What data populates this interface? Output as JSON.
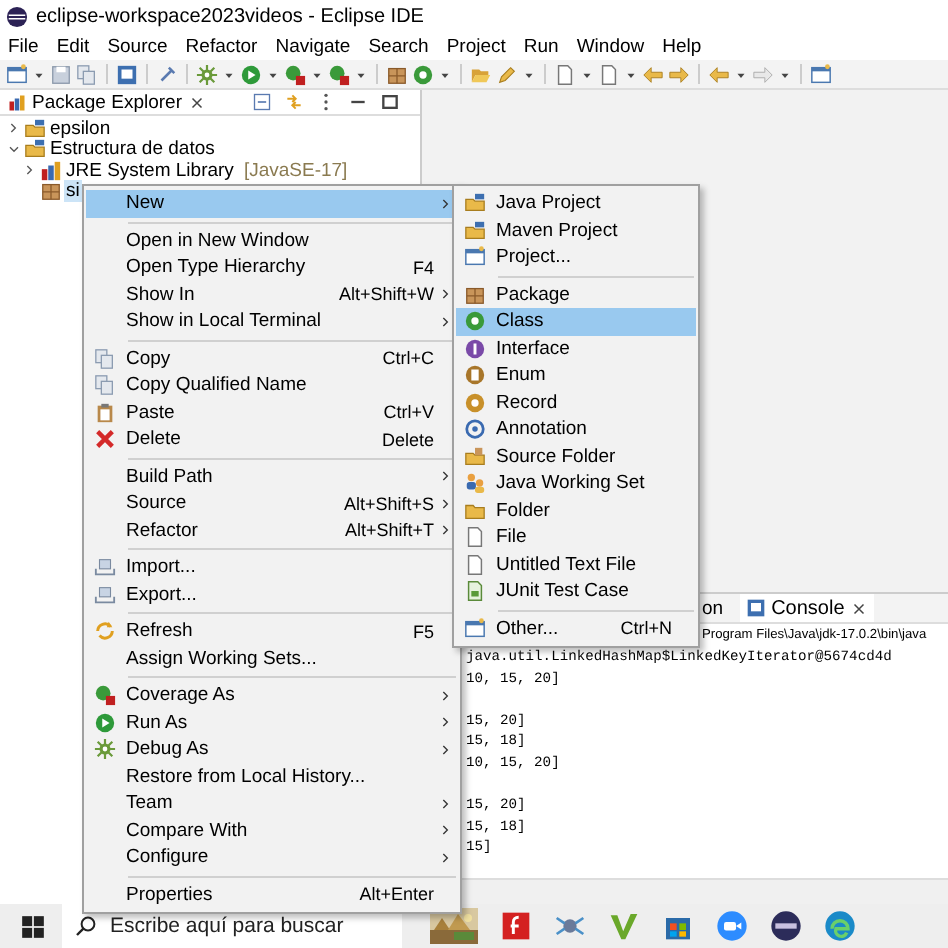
{
  "window": {
    "title": "eclipse-workspace2023videos - Eclipse IDE"
  },
  "menu_bar": [
    {
      "label": "File"
    },
    {
      "label": "Edit"
    },
    {
      "label": "Source"
    },
    {
      "label": "Refactor"
    },
    {
      "label": "Navigate"
    },
    {
      "label": "Search"
    },
    {
      "label": "Project"
    },
    {
      "label": "Run"
    },
    {
      "label": "Window"
    },
    {
      "label": "Help"
    }
  ],
  "package_explorer": {
    "title": "Package Explorer",
    "tree": [
      {
        "label": "epsilon",
        "expanded": false,
        "selected": false
      },
      {
        "label": "Estructura de datos",
        "expanded": true,
        "selected": false,
        "children": [
          {
            "label": "JRE System Library",
            "suffix": "[JavaSE-17]",
            "expanded": false,
            "selected": false
          },
          {
            "label": "si",
            "selected": true
          }
        ]
      }
    ]
  },
  "context_menu": {
    "groups": [
      [
        {
          "label": "New",
          "has_submenu": true,
          "selected": true
        }
      ],
      [
        {
          "label": "Open in New Window",
          "has_submenu": false,
          "selected": false
        },
        {
          "label": "Open Type Hierarchy",
          "shortcut": "F4",
          "has_submenu": false,
          "selected": false
        },
        {
          "label": "Show In",
          "shortcut": "Alt+Shift+W",
          "has_submenu": true,
          "selected": false
        },
        {
          "label": "Show in Local Terminal",
          "has_submenu": true,
          "selected": false
        }
      ],
      [
        {
          "label": "Copy",
          "shortcut": "Ctrl+C",
          "has_submenu": false,
          "selected": false
        },
        {
          "label": "Copy Qualified Name",
          "has_submenu": false,
          "selected": false
        },
        {
          "label": "Paste",
          "shortcut": "Ctrl+V",
          "has_submenu": false,
          "selected": false
        },
        {
          "label": "Delete",
          "shortcut": "Delete",
          "has_submenu": false,
          "selected": false
        }
      ],
      [
        {
          "label": "Build Path",
          "has_submenu": true,
          "selected": false
        },
        {
          "label": "Source",
          "shortcut": "Alt+Shift+S",
          "has_submenu": true,
          "selected": false
        },
        {
          "label": "Refactor",
          "shortcut": "Alt+Shift+T",
          "has_submenu": true,
          "selected": false
        }
      ],
      [
        {
          "label": "Import...",
          "has_submenu": false,
          "selected": false
        },
        {
          "label": "Export...",
          "has_submenu": false,
          "selected": false
        }
      ],
      [
        {
          "label": "Refresh",
          "shortcut": "F5",
          "has_submenu": false,
          "selected": false
        },
        {
          "label": "Assign Working Sets...",
          "has_submenu": false,
          "selected": false
        }
      ],
      [
        {
          "label": "Coverage As",
          "has_submenu": true,
          "selected": false
        },
        {
          "label": "Run As",
          "has_submenu": true,
          "selected": false
        },
        {
          "label": "Debug As",
          "has_submenu": true,
          "selected": false
        },
        {
          "label": "Restore from Local History...",
          "has_submenu": false,
          "selected": false
        },
        {
          "label": "Team",
          "has_submenu": true,
          "selected": false
        },
        {
          "label": "Compare With",
          "has_submenu": true,
          "selected": false
        },
        {
          "label": "Configure",
          "has_submenu": true,
          "selected": false
        }
      ],
      [
        {
          "label": "Properties",
          "shortcut": "Alt+Enter",
          "has_submenu": false,
          "selected": false
        }
      ]
    ]
  },
  "submenu": {
    "groups": [
      [
        {
          "label": "Java Project",
          "selected": false
        },
        {
          "label": "Maven Project",
          "selected": false
        },
        {
          "label": "Project...",
          "selected": false
        }
      ],
      [
        {
          "label": "Package",
          "selected": false
        },
        {
          "label": "Class",
          "selected": true
        },
        {
          "label": "Interface",
          "selected": false
        },
        {
          "label": "Enum",
          "selected": false
        },
        {
          "label": "Record",
          "selected": false
        },
        {
          "label": "Annotation",
          "selected": false
        },
        {
          "label": "Source Folder",
          "selected": false
        },
        {
          "label": "Java Working Set",
          "selected": false
        },
        {
          "label": "Folder",
          "selected": false
        },
        {
          "label": "File",
          "selected": false
        },
        {
          "label": "Untitled Text File",
          "selected": false
        },
        {
          "label": "JUnit Test Case",
          "selected": false
        }
      ],
      [
        {
          "label": "Other...",
          "shortcut": "Ctrl+N",
          "selected": false
        }
      ]
    ]
  },
  "console": {
    "partial_tab": "on",
    "tab": "Console",
    "header": "Program Files\\Java\\jdk-17.0.2\\bin\\java",
    "blocks": [
      [
        "java.util.LinkedHashMap$LinkedKeyIterator@5674cd4d",
        "10, 15, 20]"
      ],
      [
        "15, 20]",
        "15, 18]",
        "10, 15, 20]"
      ],
      [
        "15, 20]",
        "15, 18]",
        "15]"
      ]
    ]
  },
  "taskbar": {
    "search_placeholder": "Escribe aquí para buscar"
  }
}
